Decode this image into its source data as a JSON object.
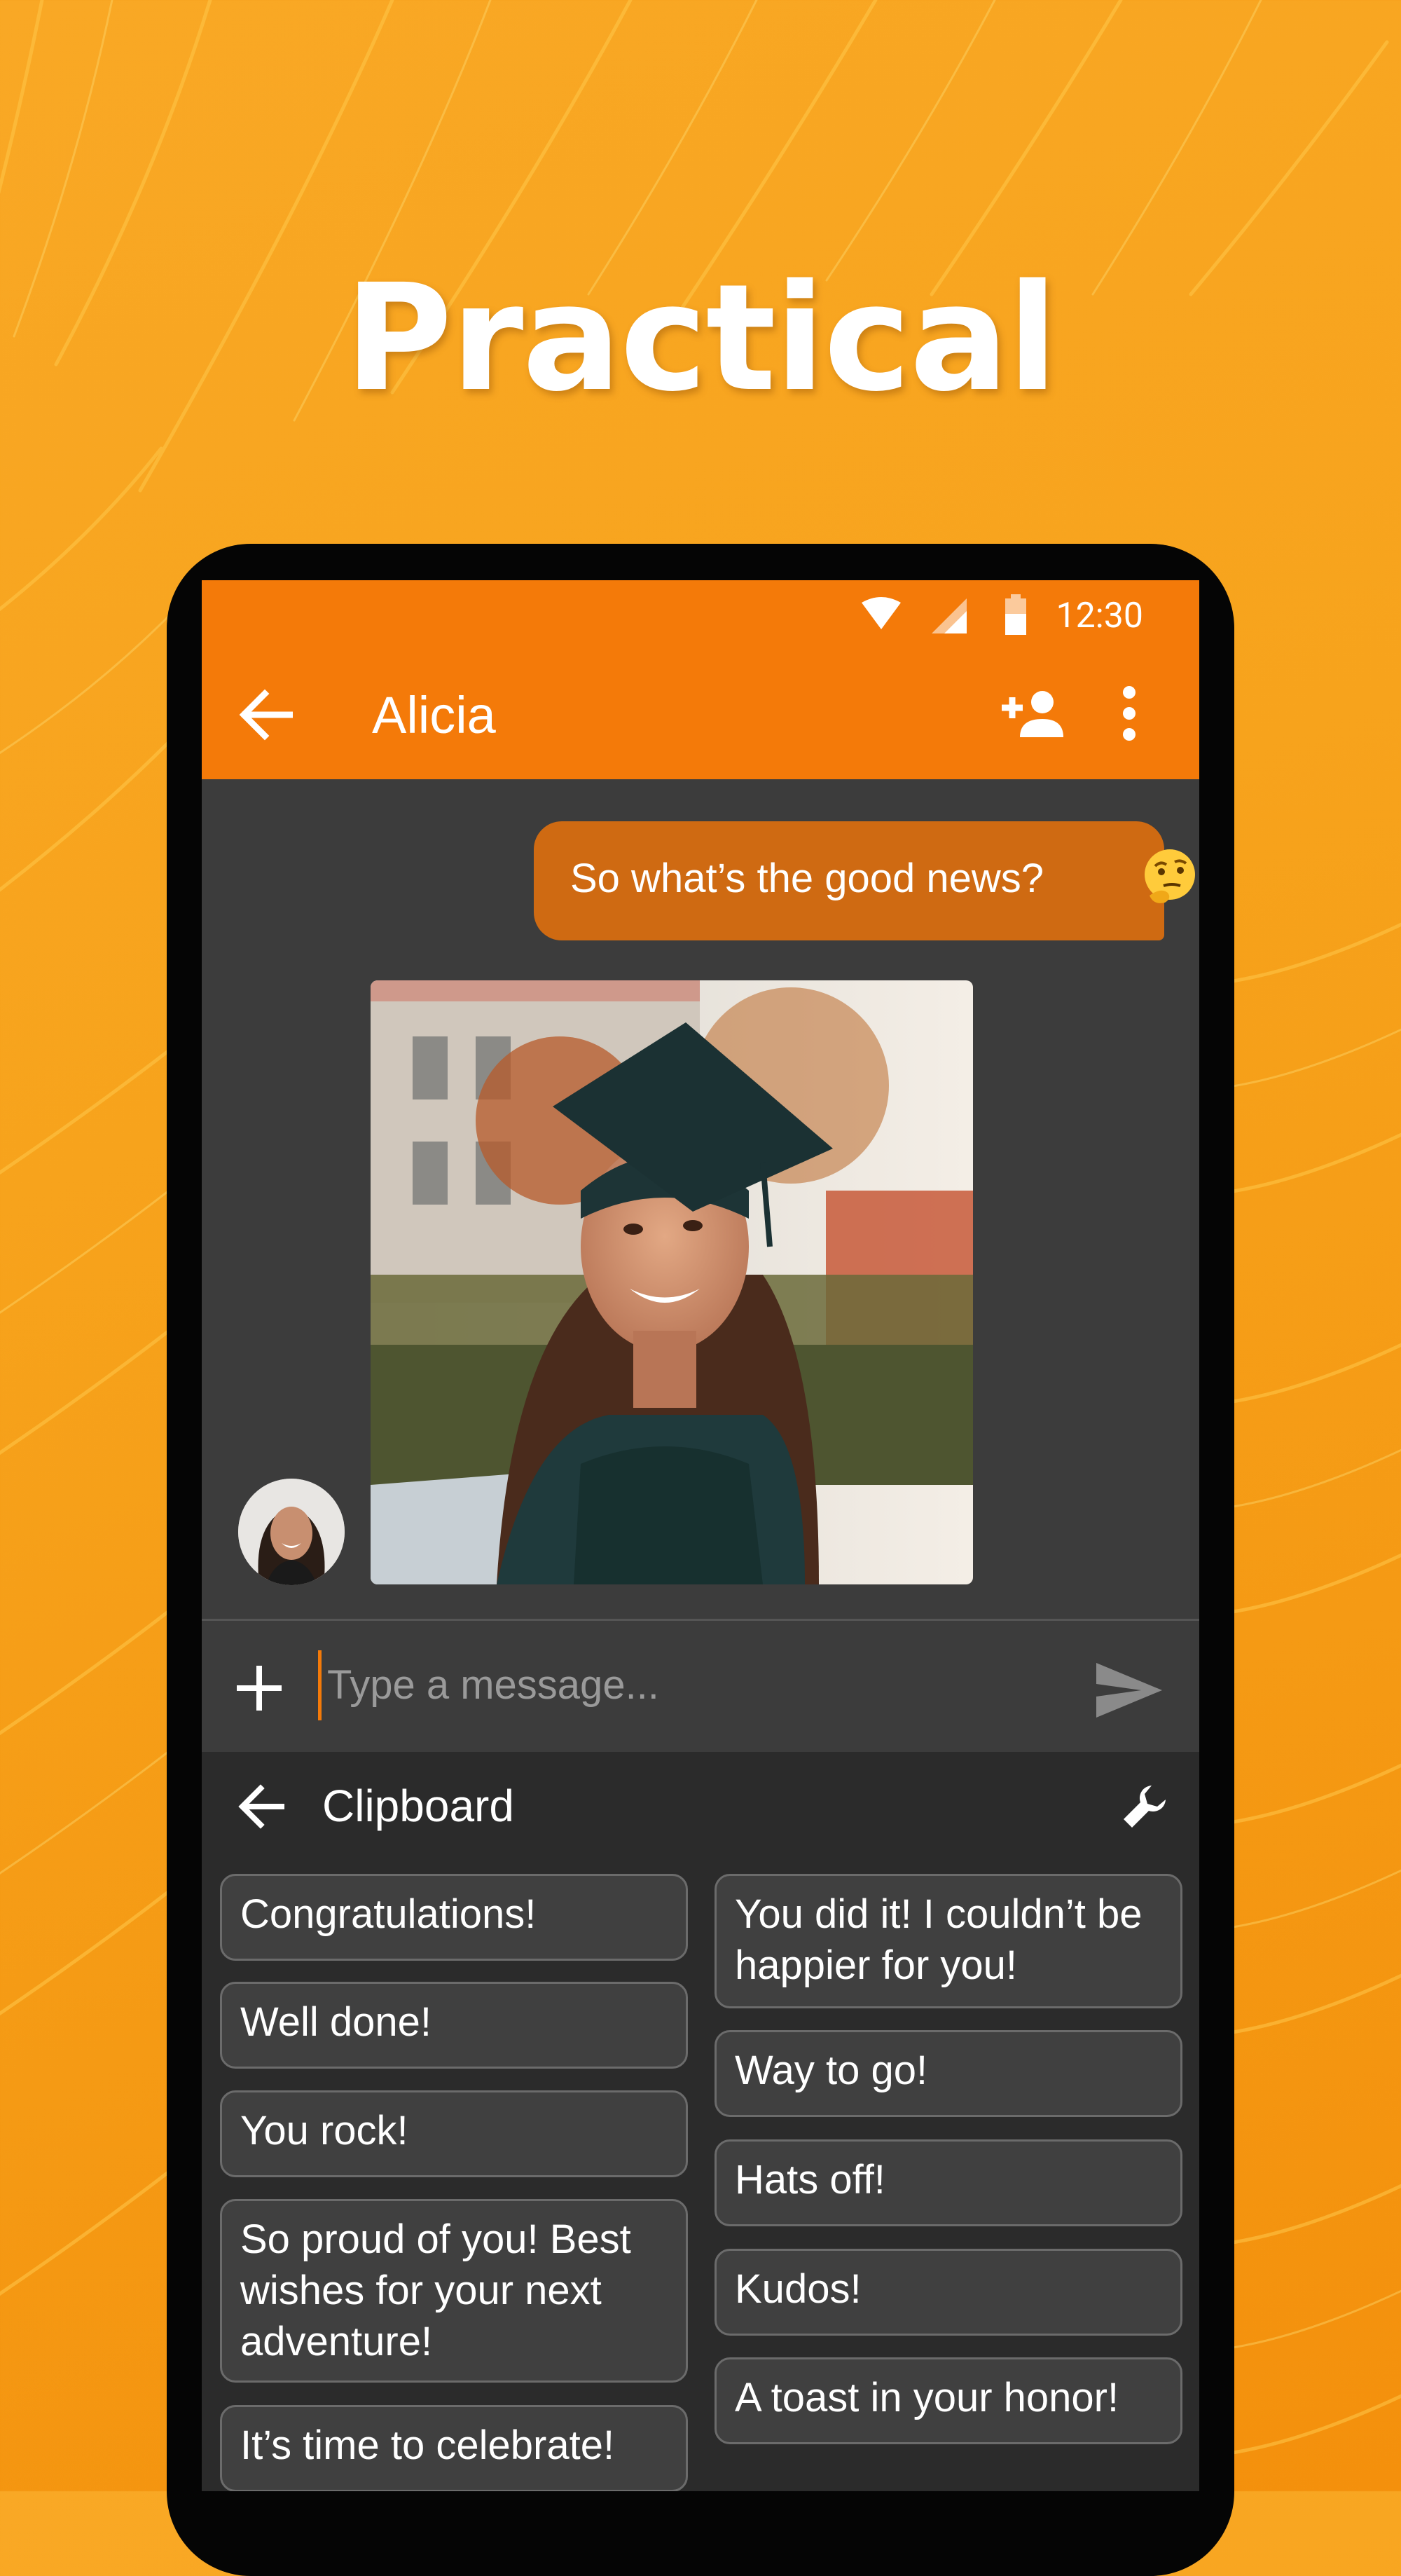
{
  "headline": "Practical",
  "status": {
    "time": "12:30"
  },
  "appbar": {
    "title": "Alicia"
  },
  "chat": {
    "outgoing_message": "So what’s the good news?",
    "outgoing_emoji": "thinking-face"
  },
  "composer": {
    "placeholder": "Type a message..."
  },
  "clipboard": {
    "title": "Clipboard",
    "left_items": [
      "Congratulations!",
      "Well done!",
      "You rock!",
      "So proud of you! Best wishes for your next adventure!",
      "It’s time to celebrate!"
    ],
    "right_items": [
      "You did it! I couldn’t be happier for you!",
      "Way to go!",
      "Hats off!",
      "Kudos!",
      "A toast in your honor!"
    ]
  },
  "colors": {
    "accent": "#f47a09",
    "outgoing_bubble": "#cf6a12",
    "chat_background": "#3c3c3c",
    "clipboard_background": "#2b2b2b"
  },
  "icons": {
    "status": [
      "wifi-icon",
      "signal-icon",
      "battery-icon"
    ],
    "appbar": [
      "back-arrow-icon",
      "add-person-icon",
      "more-vert-icon"
    ],
    "composer": [
      "plus-icon",
      "send-icon"
    ],
    "clipboard": [
      "back-arrow-icon",
      "wrench-icon"
    ]
  }
}
